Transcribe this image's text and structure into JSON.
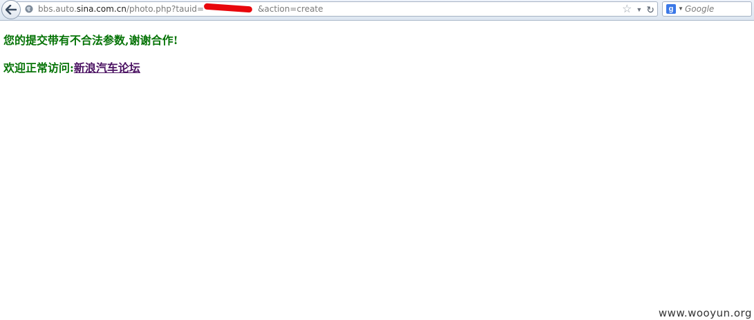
{
  "browser": {
    "url_prefix": "bbs.auto.",
    "url_host": "sina.com.cn",
    "url_path": "/photo.php?tauid=",
    "url_suffix": "&action=create",
    "search_placeholder": "Google",
    "icons": {
      "back": "back-arrow-icon",
      "site": "globe-icon",
      "bookmark": "star-icon",
      "history": "dropdown-icon",
      "reload": "reload-icon",
      "engine": "google-icon"
    }
  },
  "page": {
    "message": "您的提交带有不合法参数,谢谢合作!",
    "welcome_label": "欢迎正常访问:",
    "link_text": "新浪汽车论坛",
    "text_color": "#057306",
    "link_color": "#4b1262"
  },
  "watermark": "www.wooyun.org",
  "colors": {
    "redaction": "#e8070c"
  }
}
